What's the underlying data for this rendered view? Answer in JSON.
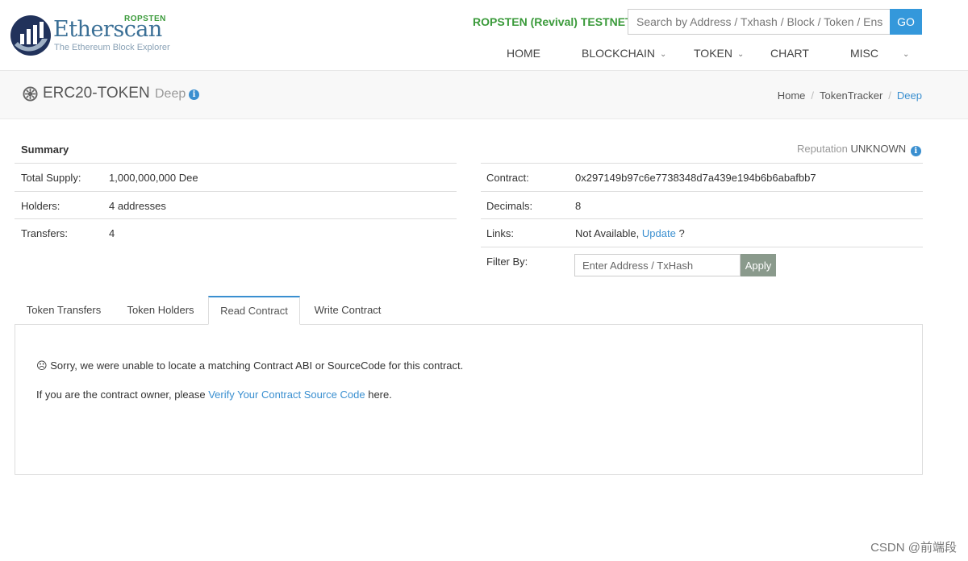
{
  "header": {
    "logo_word": "Etherscan",
    "logo_tagline": "The Ethereum Block Explorer",
    "logo_network": "ROPSTEN",
    "network_label": "ROPSTEN (Revival) TESTNET",
    "search_placeholder": "Search by Address / Txhash / Block / Token / Ens",
    "go_label": "GO",
    "nav": [
      "HOME",
      "BLOCKCHAIN",
      "TOKEN",
      "CHART",
      "MISC"
    ]
  },
  "title_band": {
    "title": "ERC20-TOKEN",
    "subtitle": "Deep",
    "breadcrumb": [
      "Home",
      "TokenTracker",
      "Deep"
    ]
  },
  "summary": {
    "heading": "Summary",
    "reputation_label": "Reputation",
    "reputation_value": "UNKNOWN",
    "left_rows": [
      {
        "key": "Total Supply:",
        "value": "1,000,000,000 Dee"
      },
      {
        "key": "Holders:",
        "value": "4 addresses"
      },
      {
        "key": "Transfers:",
        "value": "4"
      }
    ],
    "right_rows": {
      "contract_key": "Contract:",
      "contract_value": "0x297149b97c6e7738348d7a439e194b6b6abafbb7",
      "decimals_key": "Decimals:",
      "decimals_value": "8",
      "links_key": "Links:",
      "links_value": "Not Available,",
      "links_update": "Update",
      "links_q": "?",
      "filter_key": "Filter By:",
      "filter_placeholder": "Enter Address / TxHash",
      "apply_label": "Apply"
    }
  },
  "tabs": [
    "Token Transfers",
    "Token Holders",
    "Read Contract",
    "Write Contract"
  ],
  "active_tab": "Read Contract",
  "panel": {
    "sorry_icon": "☹",
    "sorry_text": "Sorry, we were unable to locate a matching Contract ABI or SourceCode for this contract.",
    "owner_prefix": "If you are the contract owner, please",
    "owner_link": "Verify Your Contract Source Code",
    "owner_suffix": "here."
  },
  "watermark": "CSDN @前端段",
  "colors": {
    "brand_blue": "#3a6f96",
    "link_blue": "#3a8fd0",
    "testnet_green": "#3a9a3a",
    "go_button": "#3498db",
    "apply_button": "#8a9a8c"
  }
}
